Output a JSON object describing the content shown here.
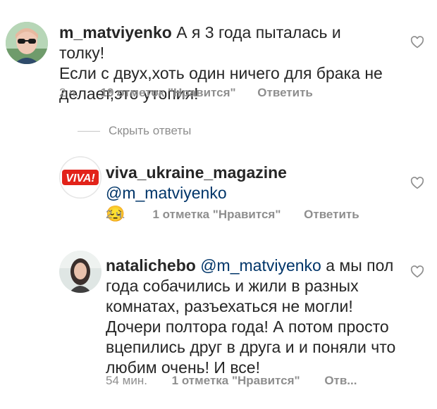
{
  "comments": [
    {
      "username": "m_matviyenko",
      "text_lines": [
        "А я 3 года пыталась и толку!",
        "Если с двух,хоть один ничего для брака не",
        "делает,это утопия!"
      ],
      "time": "2 ч.",
      "likes": "19 отметок \"Нравится\"",
      "reply": "Ответить",
      "heart_icon": "heart-outline-icon"
    }
  ],
  "hide_replies": "Скрыть ответы",
  "replies": [
    {
      "username": "viva_ukraine_magazine",
      "mention": "@m_matviyenko",
      "emoji": "😔",
      "time": "2 ч.",
      "likes": "1 отметка \"Нравится\"",
      "reply": "Ответить",
      "avatar_logo_text": "VIVA!"
    },
    {
      "username": "natalichebo",
      "mention": "@m_matviyenko",
      "text_first": " а мы пол",
      "text_lines": [
        "года собачились и жили в разных",
        "комнатах, разъехаться не могли!",
        "Дочери полтора года! А потом просто",
        "вцепились друг в друга и и поняли что",
        "любим очень! И все!"
      ],
      "time": "54 мин.",
      "likes": "1 отметка \"Нравится\"",
      "reply": "Отв..."
    }
  ],
  "colors": {
    "text": "#262626",
    "muted": "#8e8e8e",
    "mention": "#003569",
    "viva_red": "#e2231a"
  }
}
